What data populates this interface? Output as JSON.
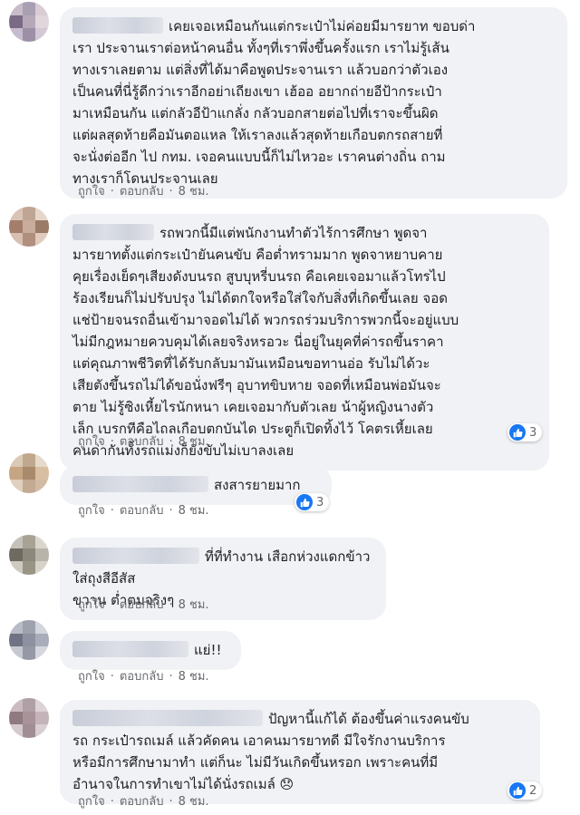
{
  "actions": {
    "like": "ถูกใจ",
    "reply": "ตอบกลับ",
    "sep": "·"
  },
  "colors": {
    "bubble": "#f0f2f5",
    "meta": "#65676b",
    "like_blue": "#1877f2"
  },
  "comments": [
    {
      "text": "เคยเจอเหมือนกันแต่กระเป๋าไม่ค่อยมีมารยาท ขอบด่า\nเรา ประจานเราต่อหน้าคนอื่น ทั้งๆที่เราพึ่งขึ้นครั้งแรก เราไม่รู้เส้น\nทางเราเลยตาม แต่สิ่งที่ได้มาคือพูดประจานเรา แล้วบอกว่าตัวเอง\nเป็นคนที่นี่รู้ดีกว่าเราอีกอย่าเถียงเขา เฮ้ออ อยากถ่ายอีป้ากระเป๋า\nมาเหมือนกัน แต่กลัวอีป้าแกลั่ง กลัวบอกสายต่อไปที่เราจะขึ้นผิด\nแต่ผลสุดท้ายคือมันตอแหล ให้เราลงแล้วสุดท้ายเกือบตกรถสายที่\nจะนั่งต่ออีก ไป กทม. เจอคนแบบนี้ก็ไม่ไหวอะ เราคนต่างถิ่น ถาม\nทางเราก็โดนประจานเลย",
      "time": "8 ชม.",
      "reactions": ""
    },
    {
      "text": "รถพวกนี้มีแต่พนักงานทำตัวไร้การศึกษา พูดจา\nมารยาทตั้งแต่กระเป๋ายันคนขับ คือต่ำทรามมาก พูดจาหยาบคาย\nคุยเรื่องเย็ดๆเสียงดังบนรถ สูบบุหรี่บนรถ คือเคยเจอมาแล้วโทรไป\nร้องเรียนก็ไม่ปรับปรุง ไม่ได้ตกใจหรือใส่ใจกับสิ่งที่เกิดขึ้นเลย จอด\nแช่ป้ายจนรถอื่นเข้ามาจอดไม่ได้ พวกรถร่วมบริการพวกนี้จะอยู่แบบ\nไม่มีกฎหมายควบคุมได้เลยจริงหรอวะ นี่อยู่ในยุคที่ค่ารถขึ้นราคา\nแต่คุณภาพชีวิตที่ได้รับกลับมามันเหมือนขอทานอ่อ รับไม่ได้วะ\nเสียตังขึ้นรถไม่ได้ขอนั่งฟรีๆ อุบาทขิบหาย จอดที่เหมือนพ่อมันจะ\nตาย ไม่รู้ซิงเหี้ยไรนักหนา เคยเจอมากับตัวเลย น้าผู้หญิงนางตัว\nเล็ก เบรกทีคือไถลเกือบตกบันได ประตูก็เปิดทิ้งไว้ โคตรเหี้ยเลย\nคนด่ากันทั้งรถแม่งก็ยังขับไม่เบาลงเลย",
      "time": "8 ชม.",
      "reactions": "3"
    },
    {
      "text": "สงสารยายมาก",
      "time": "8 ชม.",
      "reactions": "3"
    },
    {
      "text": "ที่ที่ทำงาน เสือกห่วงแดกข้าว ใส่ถุงสีอีสัส\nขวาน ต่ำตมจริงๆ",
      "time": "8 ชม.",
      "reactions": ""
    },
    {
      "text": "แย่!!",
      "time": "8 ชม.",
      "reactions": ""
    },
    {
      "text": "ปัญหานี้แก้ได้ ต้องขึ้นค่าแรงคนขับ\nรถ กระเป๋ารถเมล์ แล้วคัดคน เอาคนมารยาทดี มีใจรักงานบริการ\nหรือมีการศึกษามาทำ แต่ก็นะ ไม่มีวันเกิดขึ้นหรอก เพราะคนที่มี\nอำนาจในการทำเขาไม่ได้นั่งรถเมล์ 😞",
      "time": "8 ชม.",
      "reactions": "2"
    }
  ]
}
